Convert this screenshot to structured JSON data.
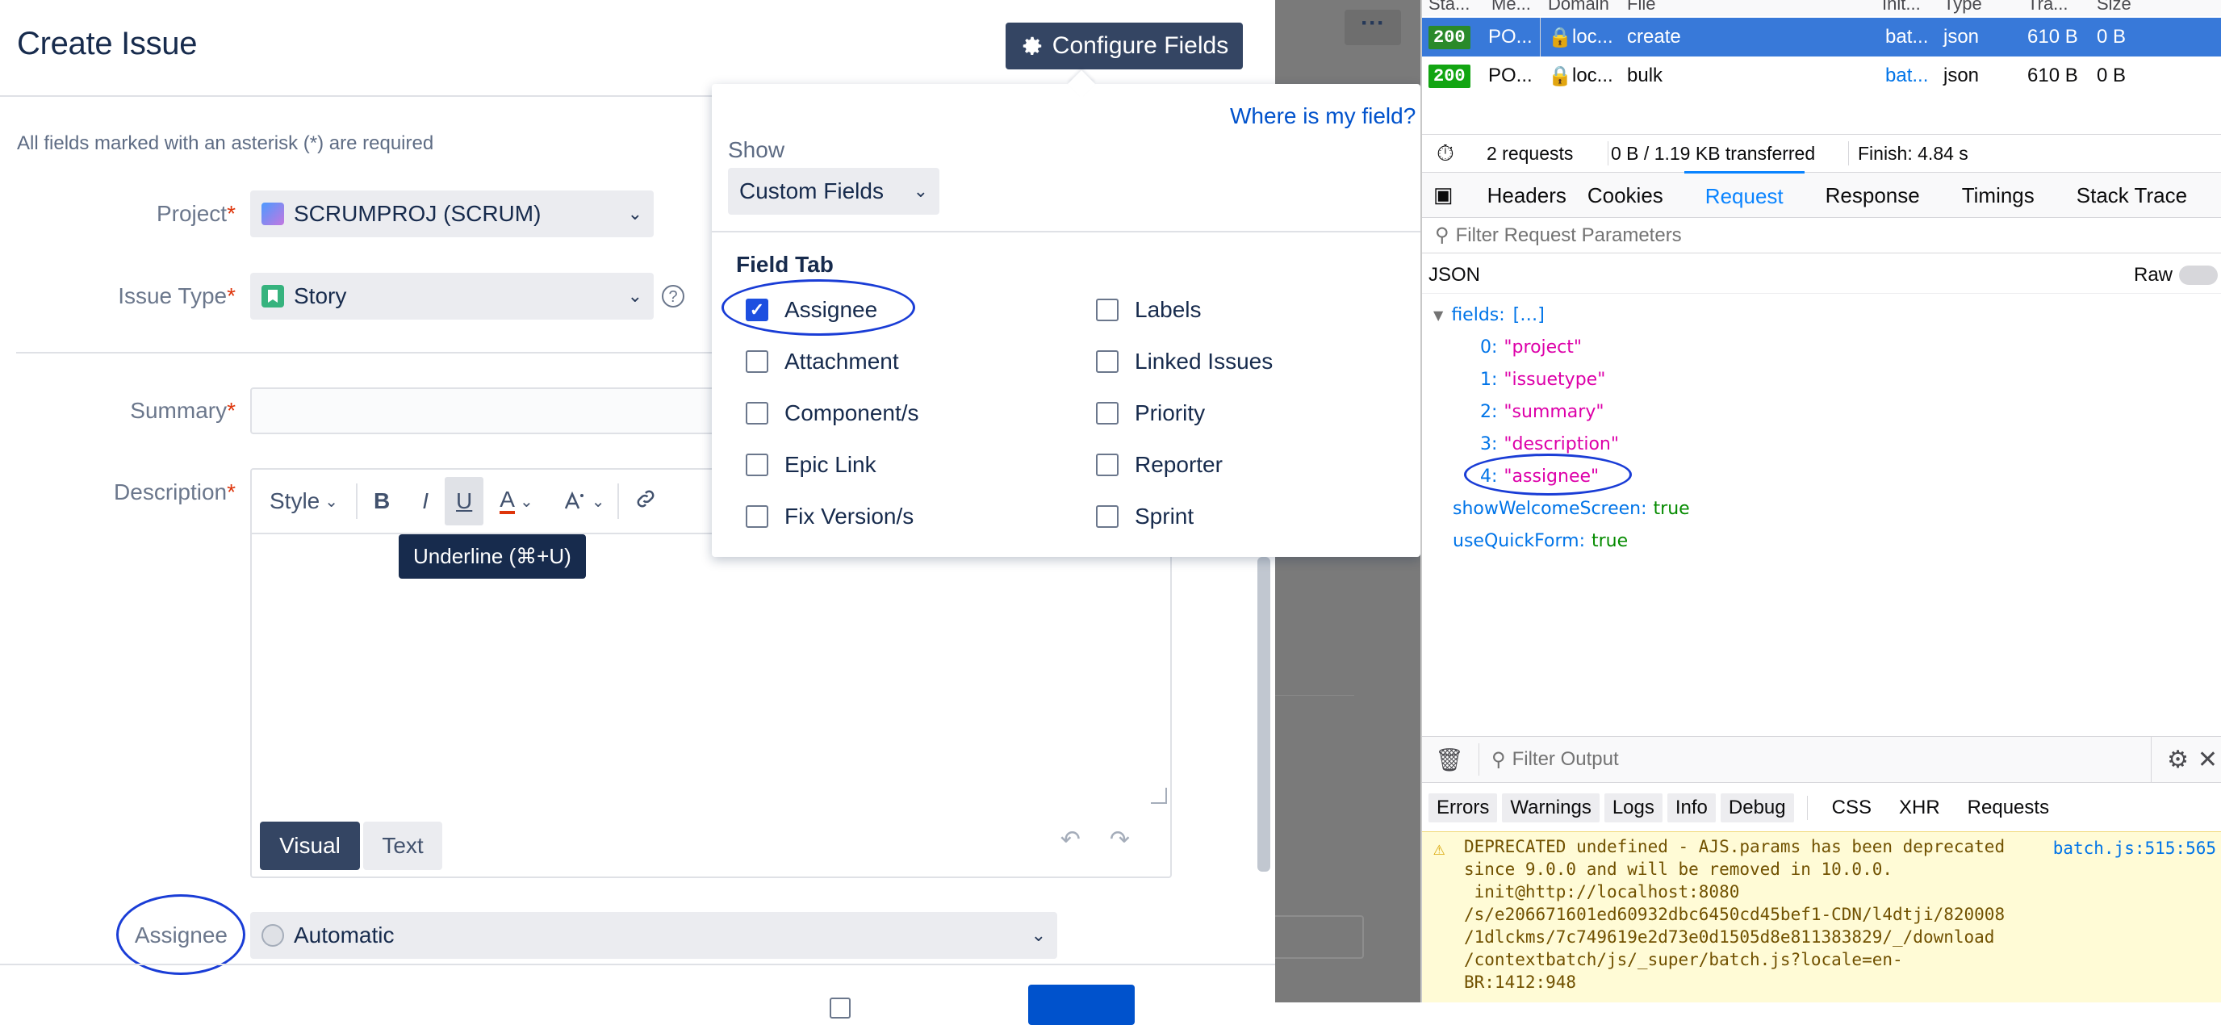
{
  "dialog": {
    "title": "Create Issue",
    "configure_button": "Configure Fields",
    "required_note": "All fields marked with an asterisk (*) are required",
    "project": {
      "label": "Project",
      "value": "SCRUMPROJ (SCRUM)"
    },
    "issue_type": {
      "label": "Issue Type",
      "value": "Story"
    },
    "summary": {
      "label": "Summary",
      "value": ""
    },
    "description": {
      "label": "Description",
      "toolbar": {
        "style": "Style",
        "bold": "B",
        "italic": "I",
        "underline": "U",
        "text_color": "A"
      },
      "tooltip": "Underline (⌘+U)",
      "visual_tab": "Visual",
      "text_tab": "Text"
    },
    "assignee": {
      "label": "Assignee",
      "value": "Automatic"
    },
    "asterisk": "*"
  },
  "popup": {
    "help_link": "Where is my field?",
    "show_label": "Show",
    "show_value": "Custom Fields",
    "section_title": "Field Tab",
    "fields_left": [
      {
        "label": "Assignee",
        "checked": true
      },
      {
        "label": "Attachment",
        "checked": false
      },
      {
        "label": "Component/s",
        "checked": false
      },
      {
        "label": "Epic Link",
        "checked": false
      },
      {
        "label": "Fix Version/s",
        "checked": false
      }
    ],
    "fields_right": [
      {
        "label": "Labels",
        "checked": false
      },
      {
        "label": "Linked Issues",
        "checked": false
      },
      {
        "label": "Priority",
        "checked": false
      },
      {
        "label": "Reporter",
        "checked": false
      },
      {
        "label": "Sprint",
        "checked": false
      }
    ]
  },
  "devtools": {
    "header_cols": [
      "Sta...",
      "Me...",
      "Domain",
      "File",
      "Init...",
      "Type",
      "Tra...",
      "Size"
    ],
    "requests": [
      {
        "status": "200",
        "method": "PO...",
        "domain": "loc...",
        "file": "create",
        "initiator": "bat...",
        "type": "json",
        "transferred": "610 B",
        "size": "0 B",
        "selected": true
      },
      {
        "status": "200",
        "method": "PO...",
        "domain": "loc...",
        "file": "bulk",
        "initiator": "bat...",
        "type": "json",
        "transferred": "610 B",
        "size": "0 B",
        "selected": false
      }
    ],
    "summary": {
      "requests": "2 requests",
      "transferred": "0 B / 1.19 KB transferred",
      "finish": "Finish: 4.84 s"
    },
    "tabs": [
      "Headers",
      "Cookies",
      "Request",
      "Response",
      "Timings",
      "Stack Trace"
    ],
    "active_tab": "Request",
    "filter_placeholder": "Filter Request Parameters",
    "json_label": "JSON",
    "raw_label": "Raw",
    "tree": {
      "fields_key": "fields:",
      "fields_summary": "[…]",
      "items": [
        {
          "idx": "0:",
          "val": "\"project\""
        },
        {
          "idx": "1:",
          "val": "\"issuetype\""
        },
        {
          "idx": "2:",
          "val": "\"summary\""
        },
        {
          "idx": "3:",
          "val": "\"description\""
        },
        {
          "idx": "4:",
          "val": "\"assignee\""
        }
      ],
      "show_welcome_key": "showWelcomeScreen:",
      "show_welcome_val": "true",
      "use_quick_key": "useQuickForm:",
      "use_quick_val": "true"
    },
    "console": {
      "filter_placeholder": "Filter Output",
      "filters": [
        "Errors",
        "Warnings",
        "Logs",
        "Info",
        "Debug"
      ],
      "extra_filters": [
        "CSS",
        "XHR",
        "Requests"
      ],
      "warning_lines": [
        "DEPRECATED undefined - AJS.params has been deprecated",
        "since 9.0.0 and will be removed in 10.0.0.",
        " init@http://localhost:8080",
        "/s/e206671601ed60932dbc6450cd45bef1-CDN/l4dtji/820008",
        "/1dlckms/7c749619e2d73e0d1505d8e811383829/_/download",
        "/contextbatch/js/_super/batch.js?locale=en-",
        "BR:1412:948"
      ],
      "warning_source": "batch.js:515:565"
    }
  },
  "colors": {
    "primary_dark": "#344563",
    "link_blue": "#0052cc",
    "annotation": "#1a3dd6",
    "devtools_selected": "#3879d9",
    "status_ok": "#12a512"
  }
}
